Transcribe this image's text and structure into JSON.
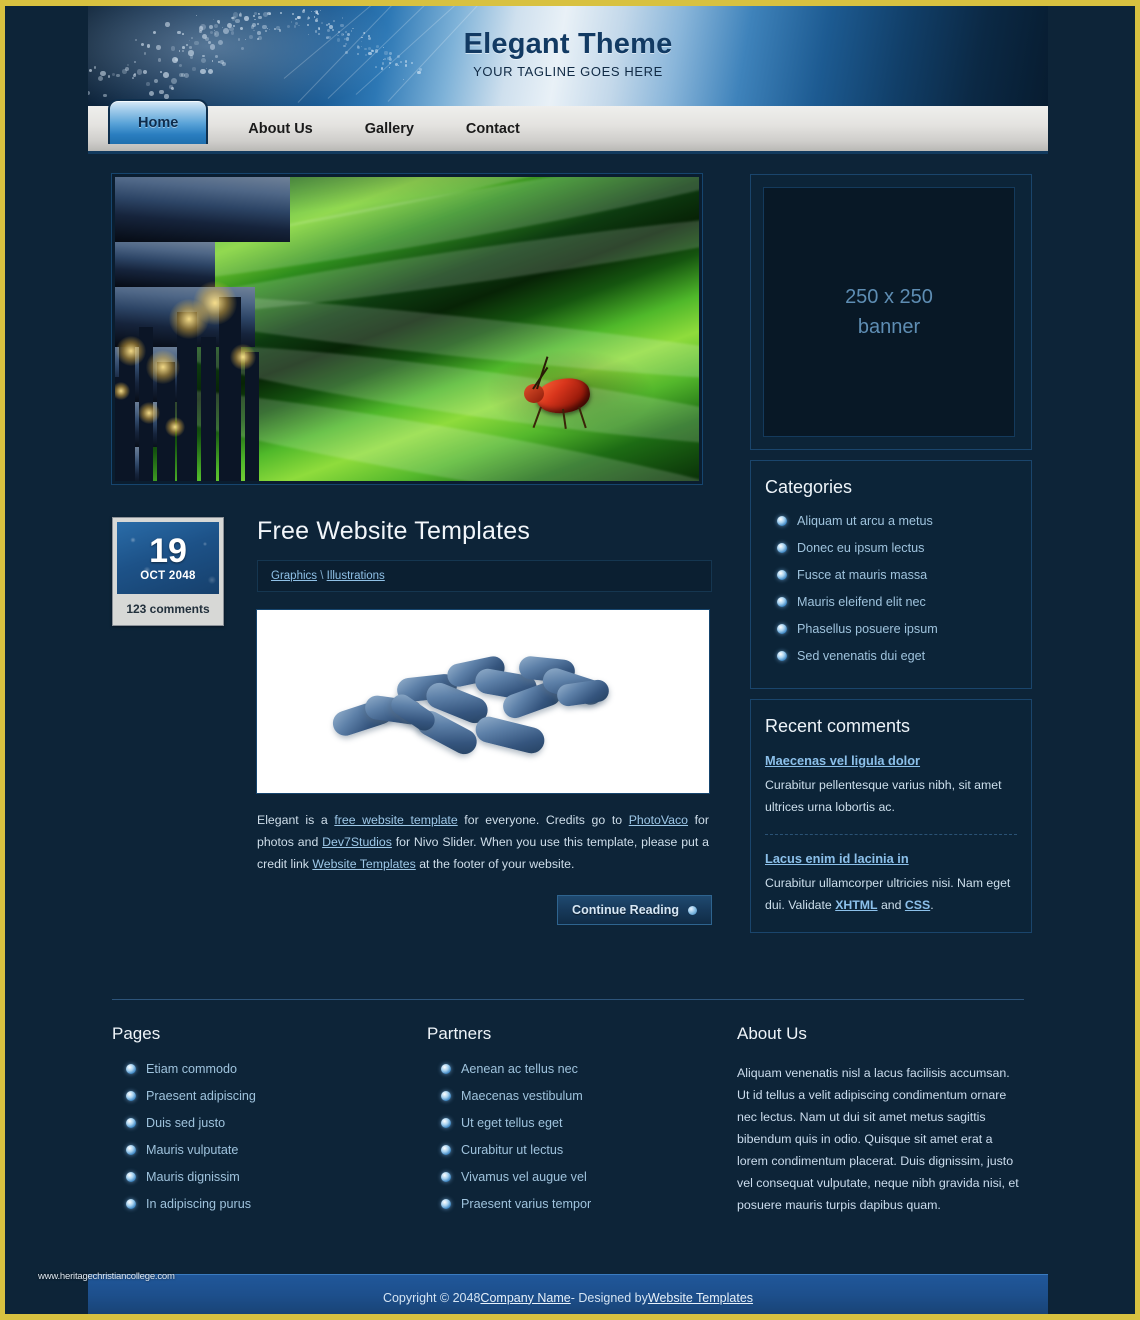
{
  "site": {
    "title": "Elegant Theme",
    "tagline": "YOUR TAGLINE GOES HERE"
  },
  "nav": {
    "items": [
      {
        "label": "Home",
        "active": true
      },
      {
        "label": "About Us",
        "active": false
      },
      {
        "label": "Gallery",
        "active": false
      },
      {
        "label": "Contact",
        "active": false
      }
    ]
  },
  "slider": {
    "alt": "nivo-slider-city-and-beetle-on-leaf"
  },
  "post": {
    "date_day": "19",
    "date_month_year": "OCT 2048",
    "comments": "123 comments",
    "title": "Free Website Templates",
    "meta": {
      "cat1": "Graphics",
      "separator": "\\",
      "cat2": "Illustrations"
    },
    "image_alt": "blue-capsules-photo",
    "text": {
      "p1a": "Elegant is a ",
      "link1": "free website template",
      "p1b": " for everyone. Credits go to ",
      "link2": "PhotoVaco",
      "p1c": " for photos and ",
      "link3": "Dev7Studios",
      "p1d": " for Nivo Slider. When you use this template, please put a credit link ",
      "link4": "Website Templates",
      "p1e": " at the footer of your website."
    },
    "continue_label": "Continue Reading"
  },
  "sidebar": {
    "banner": {
      "line1": "250 x 250",
      "line2": "banner"
    },
    "categories": {
      "title": "Categories",
      "items": [
        "Aliquam ut arcu a metus",
        "Donec eu ipsum lectus",
        "Fusce at mauris massa",
        "Mauris eleifend elit nec",
        "Phasellus posuere ipsum",
        "Sed venenatis dui eget"
      ]
    },
    "recent_comments": {
      "title": "Recent comments",
      "items": [
        {
          "title": "Maecenas vel ligula dolor",
          "body": "Curabitur pellentesque varius nibh, sit amet ultrices urna lobortis ac."
        },
        {
          "title": "Lacus enim id lacinia in",
          "body_a": "Curabitur ullamcorper ultricies nisi. Nam eget dui. Validate ",
          "link_a": "XHTML",
          "body_b": " and ",
          "link_b": "CSS",
          "body_c": "."
        }
      ]
    }
  },
  "footer": {
    "pages": {
      "title": "Pages",
      "items": [
        "Etiam commodo",
        "Praesent adipiscing",
        "Duis sed justo",
        "Mauris vulputate",
        "Mauris dignissim",
        "In adipiscing purus"
      ]
    },
    "partners": {
      "title": "Partners",
      "items": [
        "Aenean ac tellus nec",
        "Maecenas vestibulum",
        "Ut eget tellus eget",
        "Curabitur ut lectus",
        "Vivamus vel augue vel",
        "Praesent varius tempor"
      ]
    },
    "about": {
      "title": "About Us",
      "text": "Aliquam venenatis nisl a lacus facilisis accumsan. Ut id tellus a velit adipiscing condimentum ornare nec lectus. Nam ut dui sit amet metus sagittis bibendum quis in odio. Quisque sit amet erat a lorem condimentum placerat. Duis dignissim, justo vel consequat vulputate, neque nibh gravida nisi, et posuere mauris turpis dapibus quam."
    }
  },
  "copyright": {
    "prefix": "Copyright © 2048 ",
    "company": "Company Name",
    "middle": " - Designed by ",
    "designer": "Website Templates"
  },
  "watermark": "www.heritagechristiancollege.com",
  "colors": {
    "frame_gold": "#d8c140",
    "page_bg": "#0d2438",
    "accent_blue": "#2a7ec0",
    "link": "#8fc0e6",
    "copyright_bar": "#1d4f8c"
  }
}
